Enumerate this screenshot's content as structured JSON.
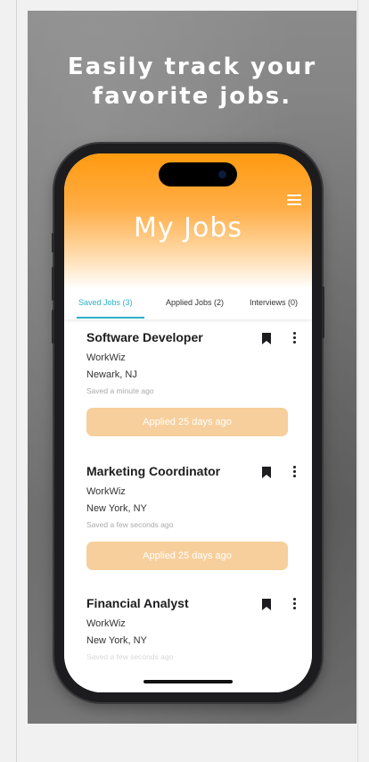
{
  "promo": {
    "headline_line1": "Easily track your",
    "headline_line2": "favorite jobs."
  },
  "app": {
    "title": "My Jobs",
    "menu_icon": "hamburger-menu-icon",
    "accent_color": "#2bb0c7",
    "header_color": "#ff9a10"
  },
  "tabs": [
    {
      "label": "Saved Jobs (3)",
      "active": true
    },
    {
      "label": "Applied Jobs (2)",
      "active": false
    },
    {
      "label": "Interviews (0)",
      "active": false
    }
  ],
  "jobs": [
    {
      "title": "Software Developer",
      "company": "WorkWiz",
      "location": "Newark, NJ",
      "saved": "Saved a minute ago",
      "applied_label": "Applied 25 days ago"
    },
    {
      "title": "Marketing Coordinator",
      "company": "WorkWiz",
      "location": "New York, NY",
      "saved": "Saved a few seconds ago",
      "applied_label": "Applied 25 days ago"
    },
    {
      "title": "Financial Analyst",
      "company": "WorkWiz",
      "location": "New York, NY",
      "saved": "Saved a few seconds ago"
    }
  ]
}
